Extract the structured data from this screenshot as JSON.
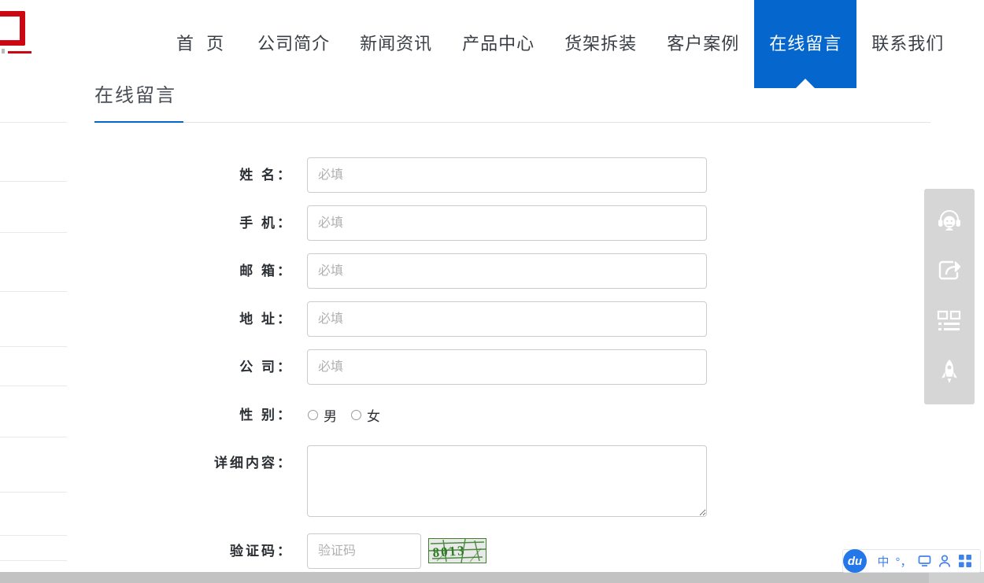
{
  "brand": {
    "logo_icon": "partial-red-logo-mark",
    "logo_color": "#cc0712"
  },
  "theme": {
    "accent": "#0566ce",
    "label_text": "#2b2f33",
    "border": "#cccccc",
    "placeholder": "#b0b0b0",
    "captcha_green": "#3f7f2c"
  },
  "nav": {
    "items": [
      {
        "label": "首 页",
        "active": false
      },
      {
        "label": "公司简介",
        "active": false
      },
      {
        "label": "新闻资讯",
        "active": false
      },
      {
        "label": "产品中心",
        "active": false
      },
      {
        "label": "货架拆装",
        "active": false
      },
      {
        "label": "客户案例",
        "active": false
      },
      {
        "label": "在线留言",
        "active": true
      },
      {
        "label": "联系我们",
        "active": false
      }
    ]
  },
  "page": {
    "title": "在线留言"
  },
  "form": {
    "rows": [
      {
        "label": "姓 名：",
        "type": "text",
        "placeholder": "必填",
        "value": ""
      },
      {
        "label": "手 机：",
        "type": "text",
        "placeholder": "必填",
        "value": ""
      },
      {
        "label": "邮 箱：",
        "type": "text",
        "placeholder": "必填",
        "value": ""
      },
      {
        "label": "地 址：",
        "type": "text",
        "placeholder": "必填",
        "value": ""
      },
      {
        "label": "公 司：",
        "type": "text",
        "placeholder": "必填",
        "value": ""
      }
    ],
    "gender": {
      "label": "性 别：",
      "options": [
        {
          "label": "男",
          "checked": false
        },
        {
          "label": "女",
          "checked": false
        }
      ]
    },
    "details": {
      "label": "详细内容：",
      "value": "",
      "placeholder": ""
    },
    "captcha": {
      "label": "验证码：",
      "placeholder": "验证码",
      "value": "",
      "image_text": "8013",
      "image_icon": "captcha-image"
    }
  },
  "side_tools": {
    "items": [
      {
        "icon": "headset-support-icon",
        "name": "customer-service"
      },
      {
        "icon": "share-arrow-icon",
        "name": "share"
      },
      {
        "icon": "qr-list-icon",
        "name": "qr-code"
      },
      {
        "icon": "rocket-icon",
        "name": "back-to-top"
      }
    ]
  },
  "ime": {
    "logo_text": "du",
    "items": [
      {
        "label": "中",
        "icon": "chinese-mode-icon"
      },
      {
        "label": "°，",
        "icon": "punctuation-mode-icon"
      },
      {
        "label": "",
        "icon": "monitor-icon"
      },
      {
        "label": "",
        "icon": "person-icon"
      },
      {
        "label": "",
        "icon": "grid-menu-icon"
      }
    ]
  },
  "scrollbar": {
    "orientation": "horizontal"
  }
}
